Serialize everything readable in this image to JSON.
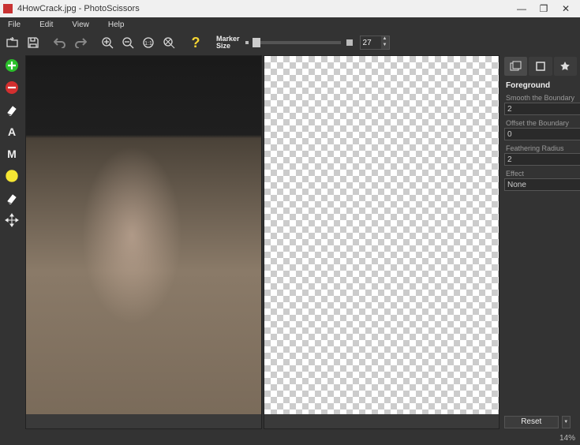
{
  "titlebar": {
    "filename": "4HowCrack.jpg",
    "appname": "PhotoScissors"
  },
  "menubar": {
    "file": "File",
    "edit": "Edit",
    "view": "View",
    "help": "Help"
  },
  "toolbar": {
    "marker_label_1": "Marker",
    "marker_label_2": "Size",
    "marker_value": "27"
  },
  "rightpanel": {
    "section_title": "Foreground",
    "smooth_label": "Smooth the Boundary",
    "smooth_value": "2",
    "offset_label": "Offset the Boundary",
    "offset_value": "0",
    "feather_label": "Feathering Radius",
    "feather_value": "2",
    "effect_label": "Effect",
    "effect_value": "None"
  },
  "footer": {
    "reset_label": "Reset",
    "zoom_label": "14%"
  }
}
